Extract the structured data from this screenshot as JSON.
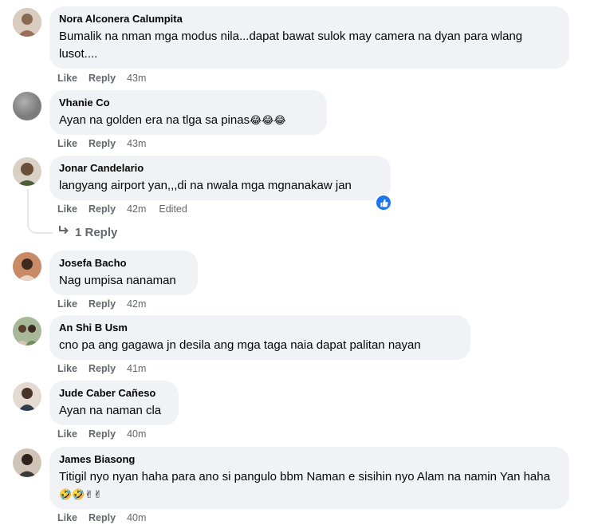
{
  "actions": {
    "like": "Like",
    "reply": "Reply"
  },
  "comments": [
    {
      "author": "Nora Alconera Calumpita",
      "text": "Bumalik na nman mga modus nila...dapat bawat sulok may camera na dyan para wlang lusot....",
      "time": "43m",
      "avatar_color": "#b9a58d"
    },
    {
      "author": "Vhanie Co",
      "text": "Ayan na golden era na tlga sa pinas",
      "emojis": "😂😂😂",
      "time": "43m",
      "avatar_color": "#9a9a9a"
    },
    {
      "author": "Jonar Candelario",
      "text": "langyang airport yan,,,di na nwala mga mgnanakaw jan",
      "time": "42m",
      "edited": "Edited",
      "avatar_color": "#6b5a48"
    },
    {
      "author": "Josefa Bacho",
      "text": "Nag umpisa nanaman",
      "time": "42m",
      "avatar_color": "#a8663f"
    },
    {
      "author": "An Shi B Usm",
      "text": "cno pa ang gagawa jn desila ang mga taga naia dapat palitan nayan",
      "time": "41m",
      "avatar_color": "#7f9a6e"
    },
    {
      "author": "Jude Caber Cañeso",
      "text": "Ayan na naman cla",
      "time": "40m",
      "avatar_color": "#c9b6a8"
    },
    {
      "author": "James Biasong",
      "text": "Titigil nyo nyan haha para ano si pangulo bbm Naman e sisihin nyo Alam na namin Yan haha",
      "emojis": "🤣🤣✌✌",
      "time": "40m",
      "avatar_color": "#5a4a3c"
    }
  ],
  "reply_link": {
    "label": "1 Reply"
  },
  "colors": {
    "bubble": "#f0f2f5",
    "meta": "#65676b",
    "like_badge": "#1877f2"
  }
}
